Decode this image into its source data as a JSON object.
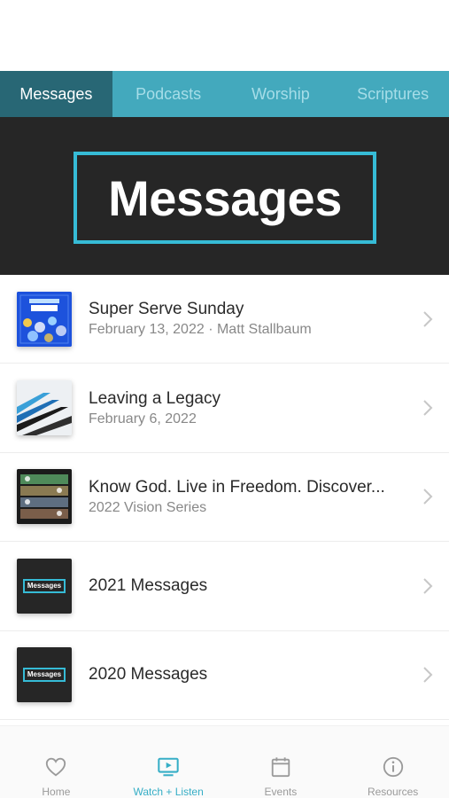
{
  "status_bar": {
    "faint_text": ""
  },
  "tabs": [
    {
      "label": "Messages",
      "active": true
    },
    {
      "label": "Podcasts",
      "active": false
    },
    {
      "label": "Worship",
      "active": false
    },
    {
      "label": "Scriptures",
      "active": false
    }
  ],
  "hero": {
    "title": "Messages"
  },
  "items": [
    {
      "title": "Super Serve Sunday",
      "subtitle": "February 13, 2022 · Matt Stallbaum",
      "thumb": "super-serve-sunday-artwork"
    },
    {
      "title": "Leaving a Legacy",
      "subtitle": "February 6, 2022",
      "thumb": "love-god-love-people-live-life-artwork"
    },
    {
      "title": "Know God. Live in Freedom. Discover...",
      "subtitle": "2022 Vision Series",
      "thumb": "vision-series-artwork"
    },
    {
      "title": "2021 Messages",
      "subtitle": "",
      "thumb": "messages-artwork",
      "thumb_text": "Messages"
    },
    {
      "title": "2020 Messages",
      "subtitle": "",
      "thumb": "messages-artwork",
      "thumb_text": "Messages"
    }
  ],
  "bottom_nav": [
    {
      "label": "Home",
      "icon": "heart-icon",
      "active": false
    },
    {
      "label": "Watch + Listen",
      "icon": "tv-play-icon",
      "active": true
    },
    {
      "label": "Events",
      "icon": "calendar-icon",
      "active": false
    },
    {
      "label": "Resources",
      "icon": "info-icon",
      "active": false
    }
  ],
  "colors": {
    "accent": "#36aec6",
    "tab_bar": "#43a9bd",
    "tab_active": "#286775",
    "hero_bg": "#262626",
    "hero_border": "#36bbd6"
  }
}
